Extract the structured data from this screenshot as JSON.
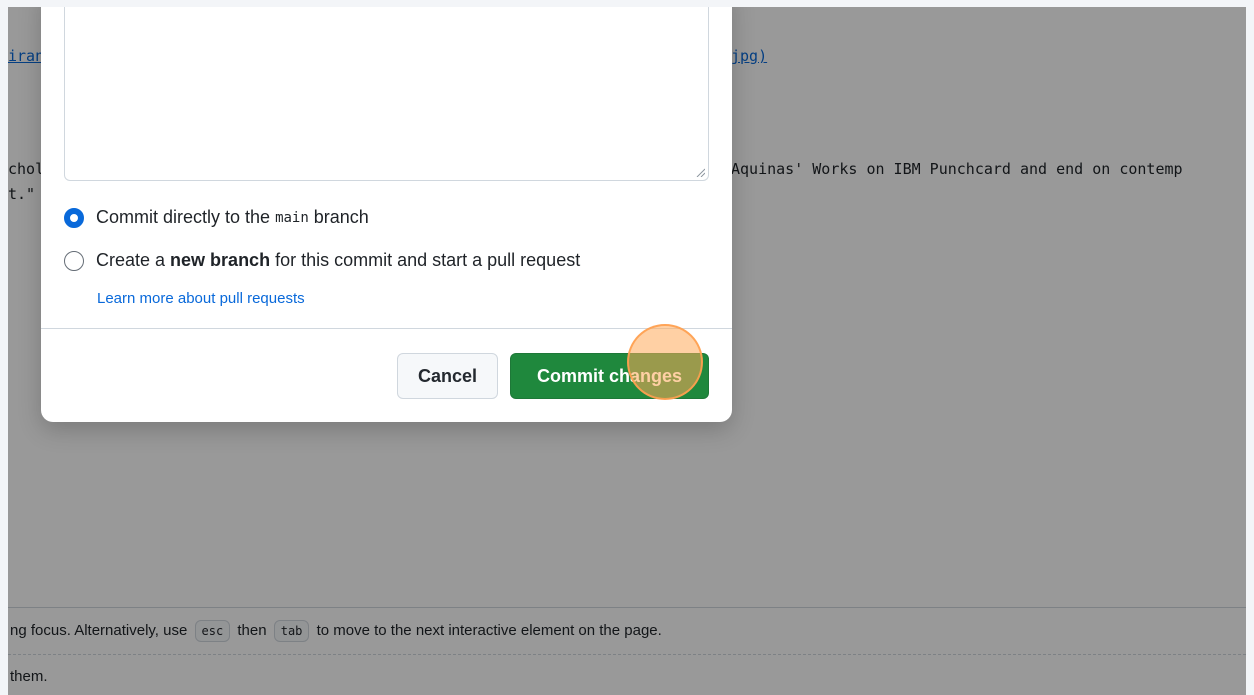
{
  "background": {
    "line1_left": "iran",
    "line1_right": "jpg)",
    "line2_left": "chol",
    "line2_right": "Aquinas' Works on IBM Punchcard and end on contemp",
    "line3_left": "t.\""
  },
  "footer": {
    "line1_before": "ng focus. Alternatively, use",
    "key_esc": "esc",
    "line1_then": "then",
    "key_tab": "tab",
    "line1_after": "to move to the next interactive element on the page.",
    "line2": "them."
  },
  "dialog": {
    "option_direct_prefix": "Commit directly to the",
    "option_direct_branch": "main",
    "option_direct_suffix": "branch",
    "option_new_prefix": "Create a",
    "option_new_bold": "new branch",
    "option_new_suffix": "for this commit and start a pull request",
    "learn_more_link": "Learn more about pull requests",
    "cancel_label": "Cancel",
    "commit_label": "Commit changes",
    "selected_option": "direct"
  },
  "colors": {
    "primary_button": "#1f883d",
    "link": "#0969da",
    "click_indicator": "#ffaa5a"
  }
}
